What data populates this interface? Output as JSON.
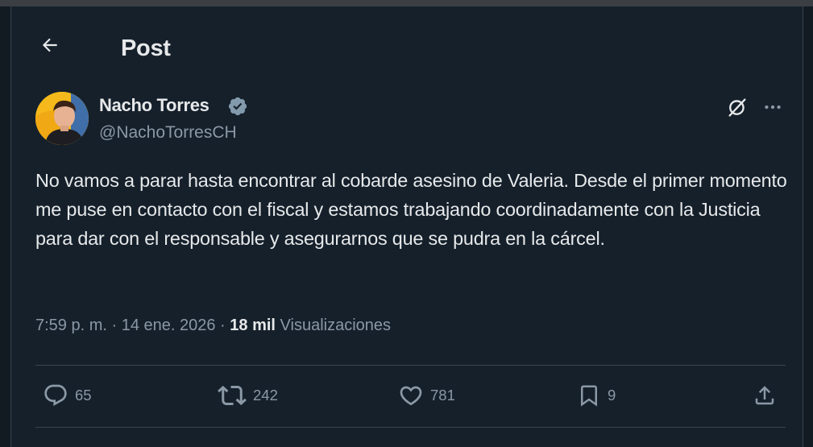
{
  "header": {
    "title": "Post"
  },
  "post": {
    "author_name": "Nacho Torres",
    "handle": "@NachoTorresCH",
    "text": "No vamos a parar hasta encontrar al cobarde asesino de Valeria. Desde el primer momento me puse en contacto con el fiscal y estamos trabajando coordinadamente con la Justicia para dar con el responsable y asegurarnos que se pudra en la cárcel.",
    "time": "7:59 p. m.",
    "separator": " · ",
    "date": "14 ene. 2026",
    "views_count": "18 mil",
    "views_label": " Visualizaciones"
  },
  "actions": {
    "replies": "65",
    "reposts": "242",
    "likes": "781",
    "bookmarks": "9"
  },
  "icons": {
    "back": "arrow-left-icon",
    "verified": "verified-badge-icon",
    "grok": "grok-icon",
    "more": "more-horizontal-icon",
    "reply": "reply-icon",
    "repost": "repost-icon",
    "like": "heart-icon",
    "bookmark": "bookmark-icon",
    "share": "share-icon"
  },
  "colors": {
    "background": "#15202b",
    "text": "#e7e9ea",
    "muted": "#8b98a5",
    "divider": "#38444d",
    "verified_badge": "#829aab"
  }
}
